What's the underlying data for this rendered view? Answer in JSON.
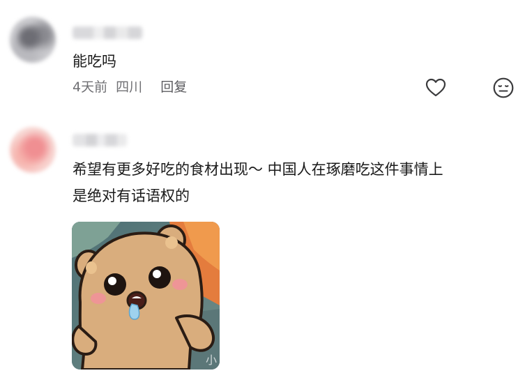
{
  "comments": [
    {
      "text": "能吃吗",
      "time": "4天前",
      "location": "四川",
      "reply_label": "回复"
    },
    {
      "text_line1": "希望有更多好吃的食材出现～ 中国人在琢磨吃这件事情上",
      "text_line2": "是绝对有话语权的",
      "sticker": {
        "icon": "drooling-bear-sticker",
        "watermark": "小"
      }
    }
  ],
  "icons": {
    "like": "heart-outline-icon",
    "emoji": "neutral-face-icon"
  },
  "colors": {
    "text_primary": "#1a1a1a",
    "text_secondary": "#6f6f73",
    "background": "#ffffff"
  }
}
